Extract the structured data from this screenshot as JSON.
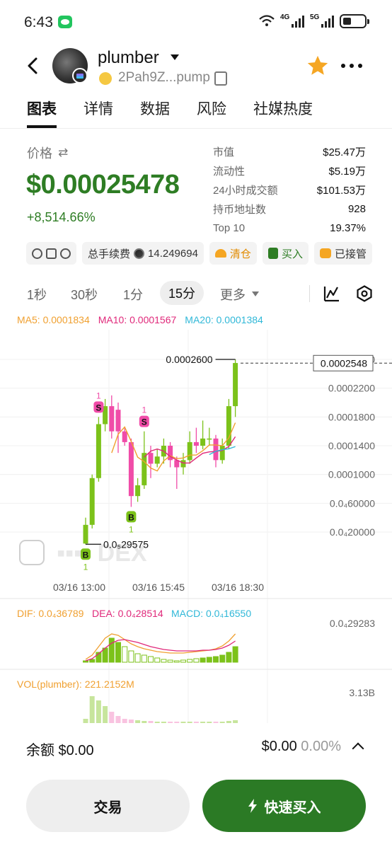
{
  "status_bar": {
    "time": "6:43",
    "net1": "4G",
    "net2": "5G"
  },
  "header": {
    "token_name": "plumber",
    "address": "2Pah9Z...pump"
  },
  "tabs": [
    {
      "label": "图表"
    },
    {
      "label": "详情"
    },
    {
      "label": "数据"
    },
    {
      "label": "风险"
    },
    {
      "label": "社媒热度"
    }
  ],
  "price_section": {
    "label": "价格",
    "price": "$0.00025478",
    "change": "+8,514.66%"
  },
  "stats": [
    {
      "key": "市值",
      "value": "$25.47万"
    },
    {
      "key": "流动性",
      "value": "$5.19万"
    },
    {
      "key": "24小时成交额",
      "value": "$101.53万"
    },
    {
      "key": "持币地址数",
      "value": "928"
    },
    {
      "key": "Top 10",
      "value": "19.37%"
    }
  ],
  "action_chips": {
    "fee_label": "总手续费",
    "fee_value": "14.249694",
    "clear": "清仓",
    "buy": "买入",
    "managed": "已接管"
  },
  "timeframes": {
    "t1": "1秒",
    "t2": "30秒",
    "t3": "1分",
    "t4": "15分",
    "more": "更多"
  },
  "ma_legend": {
    "ma5": "MA5: 0.0001834",
    "ma10": "MA10: 0.0001567",
    "ma20": "MA20: 0.0001384"
  },
  "colors": {
    "up": "#7cc21a",
    "down": "#f04ca8",
    "ma5": "#f0a030",
    "ma10": "#e0287a",
    "ma20": "#30b8d8",
    "brand_green": "#2b7a25"
  },
  "chart_data": {
    "type": "candlestick",
    "y_ticks": [
      "0.0002600",
      "0.0002200",
      "0.0001800",
      "0.0001400",
      "0.0001000",
      "0.0₄60000",
      "0.0₄20000"
    ],
    "x_ticks": [
      "03/16 13:00",
      "03/16 15:45",
      "03/16 18:30"
    ],
    "last_price": "0.0002548",
    "high_label": "0.0002600",
    "low_label": "0.0₅29575",
    "watermark": "DEX",
    "candles": [
      {
        "o": 4e-06,
        "c": 3e-05,
        "h": 4e-05,
        "l": 3e-06
      },
      {
        "o": 3e-05,
        "c": 9.5e-05,
        "h": 0.0001,
        "l": 2.5e-05
      },
      {
        "o": 9.5e-05,
        "c": 0.00017,
        "h": 0.00018,
        "l": 9e-05
      },
      {
        "o": 0.00017,
        "c": 0.000195,
        "h": 0.000205,
        "l": 0.00016
      },
      {
        "o": 0.000195,
        "c": 0.00016,
        "h": 0.00021,
        "l": 0.00015
      },
      {
        "o": 0.00019,
        "c": 0.00016,
        "h": 0.0002,
        "l": 0.00013
      },
      {
        "o": 0.00016,
        "c": 0.000145,
        "h": 0.000165,
        "l": 0.00014
      },
      {
        "o": 0.000145,
        "c": 7e-05,
        "h": 0.00015,
        "l": 5.5e-05
      },
      {
        "o": 7e-05,
        "c": 8.5e-05,
        "h": 9.5e-05,
        "l": 6.2e-05
      },
      {
        "o": 8.5e-05,
        "c": 0.00013,
        "h": 0.00016,
        "l": 8e-05
      },
      {
        "o": 0.00013,
        "c": 0.000115,
        "h": 0.00014,
        "l": 9.5e-05
      },
      {
        "o": 0.000115,
        "c": 0.000125,
        "h": 0.000135,
        "l": 0.00011
      },
      {
        "o": 0.000125,
        "c": 0.00014,
        "h": 0.00015,
        "l": 0.000115
      },
      {
        "o": 0.00014,
        "c": 0.00012,
        "h": 0.000145,
        "l": 0.00011
      },
      {
        "o": 0.00012,
        "c": 0.00011,
        "h": 0.000125,
        "l": 8e-05
      },
      {
        "o": 0.00011,
        "c": 0.00012,
        "h": 0.00013,
        "l": 0.0001
      },
      {
        "o": 0.00012,
        "c": 0.000145,
        "h": 0.00016,
        "l": 0.000115
      },
      {
        "o": 0.000145,
        "c": 0.00014,
        "h": 0.000165,
        "l": 0.00013
      },
      {
        "o": 0.00014,
        "c": 0.00015,
        "h": 0.000175,
        "l": 0.000135
      },
      {
        "o": 0.00015,
        "c": 0.00015,
        "h": 0.000165,
        "l": 0.00014
      },
      {
        "o": 0.00015,
        "c": 0.00012,
        "h": 0.000155,
        "l": 0.00011
      },
      {
        "o": 0.00012,
        "c": 0.00014,
        "h": 0.00015,
        "l": 0.000115
      },
      {
        "o": 0.00014,
        "c": 0.000195,
        "h": 0.000205,
        "l": 0.000135
      },
      {
        "o": 0.000195,
        "c": 0.000255,
        "h": 0.00026,
        "l": 0.00018
      }
    ],
    "trade_markers": [
      {
        "label": "B",
        "count": "1",
        "index": 0
      },
      {
        "label": "S",
        "count": "1",
        "index": 2
      },
      {
        "label": "B",
        "count": "1",
        "index": 7
      },
      {
        "label": "S",
        "count": "1",
        "index": 9
      }
    ]
  },
  "macd": {
    "dif": "DIF: 0.0₄36789",
    "dea": "DEA: 0.0₄28514",
    "macd": "MACD: 0.0₄16550",
    "axis_value": "0.0₄29283"
  },
  "volume": {
    "label": "VOL(plumber): 221.2152M",
    "axis_value": "3.13B"
  },
  "balance": {
    "label": "余额 $0.00",
    "right_value": "$0.00",
    "right_pct": "0.00%"
  },
  "buttons": {
    "trade": "交易",
    "quick_buy": "快速买入"
  }
}
